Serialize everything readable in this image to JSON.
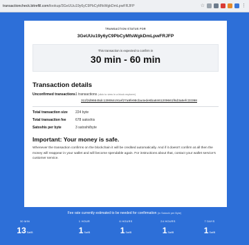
{
  "browser": {
    "url_host": "transactioncheck.bitrefill.com",
    "url_path": "/lookup/3GeUUu19y6yC9PbCyMfsWgkDmLpwFRJFP"
  },
  "status": {
    "label": "TRANSACTION STATUS FOR",
    "txid": "3GeUUu19y6yC9PbCyMfsWgkDmLpwFRJFP",
    "expect_label": "This transaction is expected to confirm in",
    "expect_range": "30 min - 60 min"
  },
  "details": {
    "title": "Transaction details",
    "unconfirmed_label": "Unconfirmed transactions",
    "unconfirmed_value": "1 transactions",
    "unconfirmed_hint": "(click to view in a block explorer)",
    "tx_hash": "311f2d96645dc139064c91ef27a9fe98cba4ede6ba8461209661f6d3a8efc33398",
    "size_label": "Total transaction size",
    "size_value": "224 byte",
    "fee_label": "Total transaction fee",
    "fee_value": "678 satoshis",
    "rate_label": "Satoshis per byte",
    "rate_value": "3 satoshi/byte"
  },
  "important": {
    "title": "Important: Your money is safe.",
    "body": "Whenever the transaction confirms on the blockchain it will be credited automatically. And if it doesn't confirm at all then the money will reappear in your wallet and will become spendable again. For instructions about that, contact your wallet service's customer service."
  },
  "fees": {
    "title": "Fee rate currently estimated to be needed for confirmation",
    "unit_note": "(in Satoshi per Byte)",
    "unit": "Sat/B",
    "columns": [
      {
        "label": "30 MIN",
        "value": "13"
      },
      {
        "label": "1 HOUR",
        "value": "1"
      },
      {
        "label": "6 HOURS",
        "value": "1"
      },
      {
        "label": "24 HOURS",
        "value": "1"
      },
      {
        "label": "7 DAYS",
        "value": "1"
      }
    ]
  }
}
